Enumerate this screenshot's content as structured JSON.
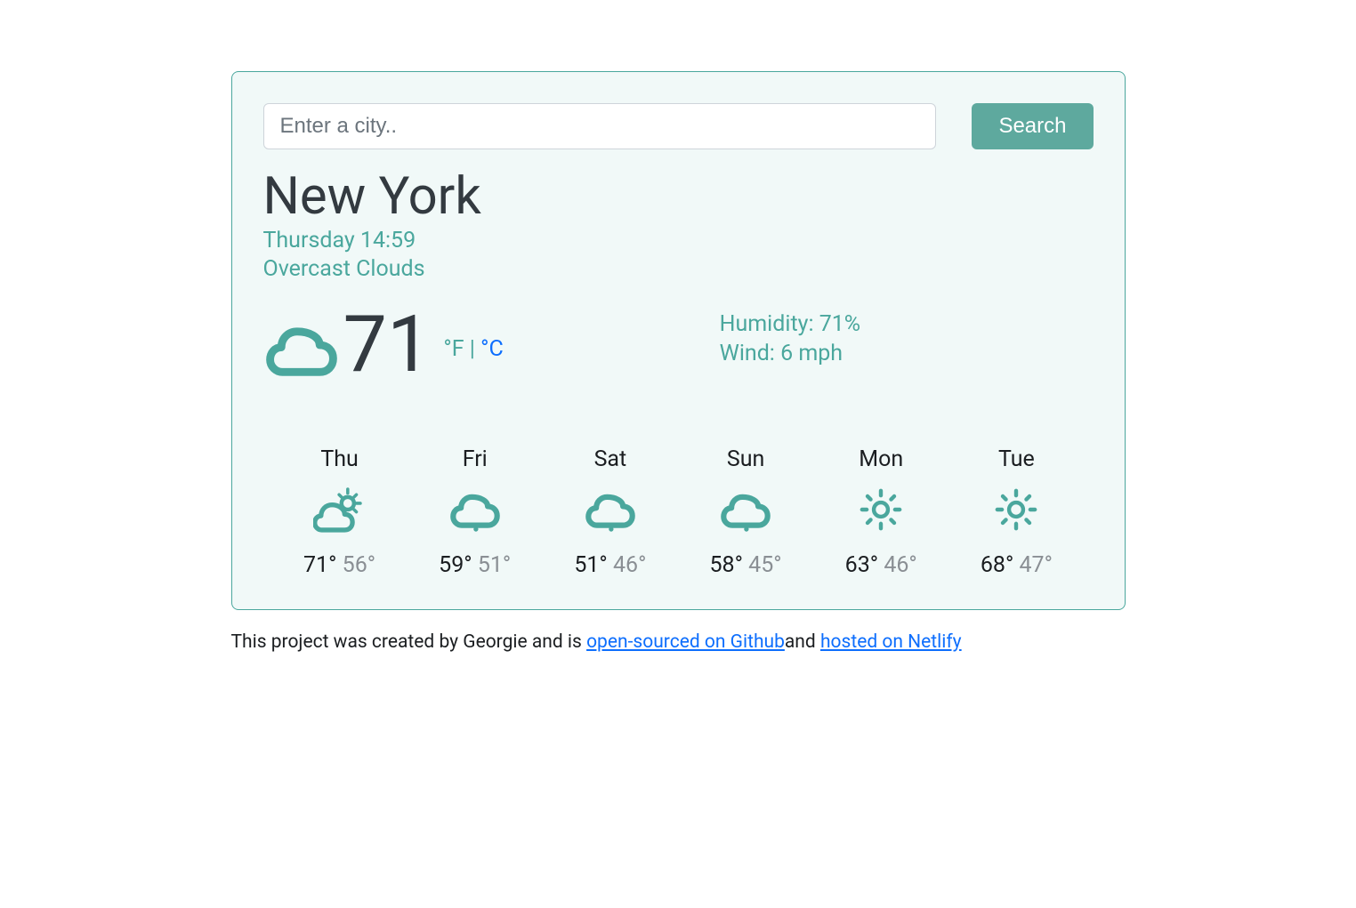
{
  "colors": {
    "accent": "#4aa79d",
    "link": "#0d6efd"
  },
  "search": {
    "placeholder": "Enter a city..",
    "button": "Search"
  },
  "location": {
    "city": "New York",
    "datetime": "Thursday 14:59",
    "conditions": "Overcast Clouds"
  },
  "current": {
    "icon": "cloud-icon",
    "temp": "71",
    "units": {
      "active": "°F",
      "separator": " | ",
      "inactive": "°C"
    },
    "humidity_label": "Humidity: ",
    "humidity_value": "71%",
    "wind_label": "Wind: ",
    "wind_value": "6 mph"
  },
  "forecast": [
    {
      "label": "Thu",
      "icon": "partly-sunny-icon",
      "hi": "71°",
      "lo": "56°"
    },
    {
      "label": "Fri",
      "icon": "rain-cloud-icon",
      "hi": "59°",
      "lo": "51°"
    },
    {
      "label": "Sat",
      "icon": "rain-cloud-icon",
      "hi": "51°",
      "lo": "46°"
    },
    {
      "label": "Sun",
      "icon": "rain-cloud-icon",
      "hi": "58°",
      "lo": "45°"
    },
    {
      "label": "Mon",
      "icon": "sun-icon",
      "hi": "63°",
      "lo": "46°"
    },
    {
      "label": "Tue",
      "icon": "sun-icon",
      "hi": "68°",
      "lo": "47°"
    }
  ],
  "footer": {
    "pre": "This project was created by Georgie and is ",
    "link1": "open-sourced on Github",
    "mid": "and ",
    "link2": "hosted on Netlify"
  }
}
